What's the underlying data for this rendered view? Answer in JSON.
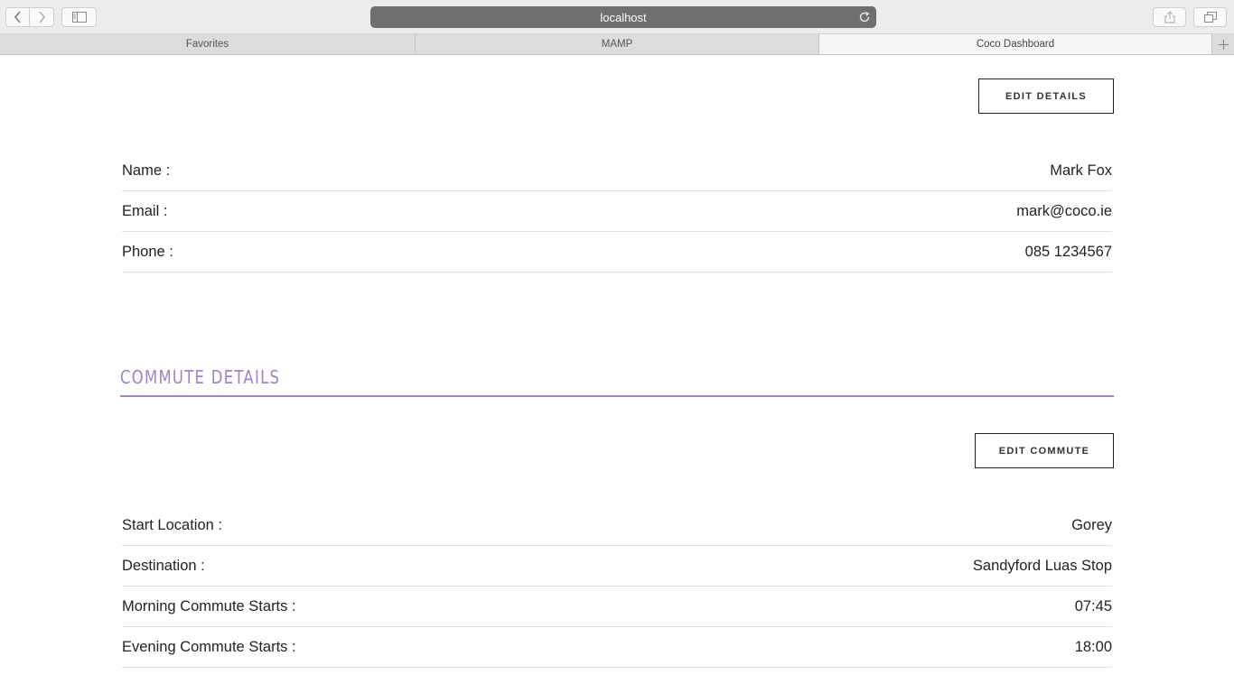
{
  "browser": {
    "url": "localhost",
    "tabs": [
      {
        "label": "Favorites"
      },
      {
        "label": "MAMP"
      },
      {
        "label": "Coco Dashboard"
      }
    ]
  },
  "personal": {
    "edit_button": "EDIT DETAILS",
    "rows": [
      {
        "label": "Name :",
        "value": "Mark Fox"
      },
      {
        "label": "Email :",
        "value": "mark@coco.ie"
      },
      {
        "label": "Phone :",
        "value": "085 1234567"
      }
    ]
  },
  "commute": {
    "title": "COMMUTE DETAILS",
    "edit_button": "EDIT COMMUTE",
    "rows": [
      {
        "label": "Start Location :",
        "value": "Gorey"
      },
      {
        "label": "Destination :",
        "value": "Sandyford Luas Stop"
      },
      {
        "label": "Morning Commute Starts :",
        "value": "07:45"
      },
      {
        "label": "Evening Commute Starts :",
        "value": "18:00"
      }
    ]
  },
  "colors": {
    "accent": "#9d84c2",
    "text": "#222222",
    "divider": "#dedede"
  }
}
